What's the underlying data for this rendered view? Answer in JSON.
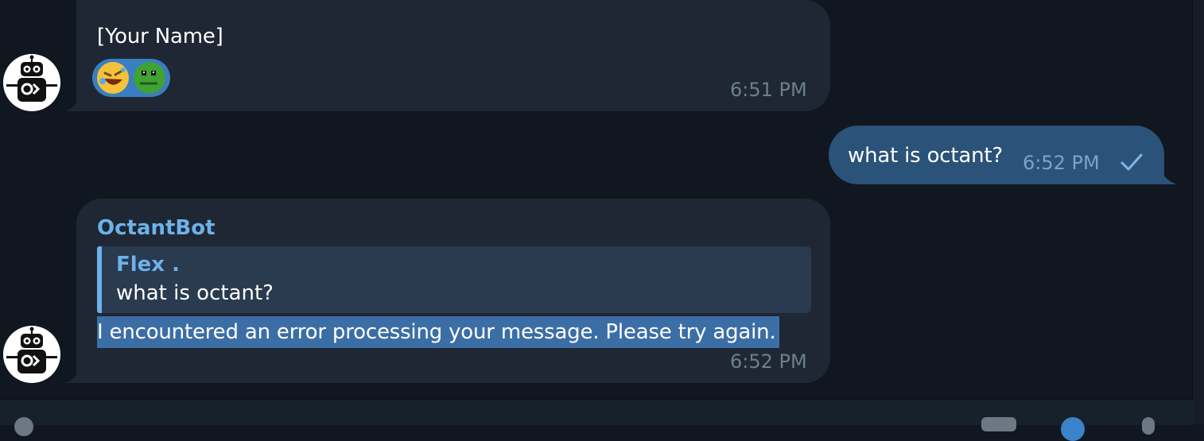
{
  "messages": [
    {
      "id": "msg-1",
      "direction": "incoming",
      "text": "[Your Name]",
      "reactions": [
        "rolling-on-floor-laughing",
        "green-frog-sticker"
      ],
      "time": "6:51 PM"
    },
    {
      "id": "msg-2",
      "direction": "outgoing",
      "text": "what is octant?",
      "time": "6:52 PM",
      "status_icon": "single-check-icon"
    },
    {
      "id": "msg-3",
      "direction": "incoming",
      "sender": "OctantBot",
      "reply_to": {
        "author": "Flex .",
        "text": "what is octant?"
      },
      "text": "I encountered an error processing your message. Please try again.",
      "time": "6:52 PM"
    }
  ],
  "colors": {
    "background": "#111720",
    "incoming_bubble": "#1e2733",
    "outgoing_bubble": "#2b5278",
    "accent": "#6cb2eb",
    "selection": "#3c6ea6"
  }
}
